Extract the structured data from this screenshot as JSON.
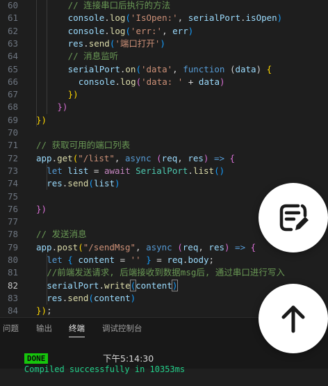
{
  "editor": {
    "lines": [
      {
        "n": "60",
        "tokens": [
          {
            "t": "// 连接串口后执行的方法",
            "c": "t-cmt"
          }
        ]
      },
      {
        "n": "61",
        "tokens": [
          {
            "t": "console",
            "c": "t-var"
          },
          {
            "t": ".",
            "c": "t-plain"
          },
          {
            "t": "log",
            "c": "t-fn"
          },
          {
            "t": "(",
            "c": "t-brk3"
          },
          {
            "t": "'IsOpen:'",
            "c": "t-str"
          },
          {
            "t": ", ",
            "c": "t-plain"
          },
          {
            "t": "serialPort",
            "c": "t-var"
          },
          {
            "t": ".",
            "c": "t-plain"
          },
          {
            "t": "isOpen",
            "c": "t-var"
          },
          {
            "t": ")",
            "c": "t-brk3"
          }
        ]
      },
      {
        "n": "62",
        "tokens": [
          {
            "t": "console",
            "c": "t-var"
          },
          {
            "t": ".",
            "c": "t-plain"
          },
          {
            "t": "log",
            "c": "t-fn"
          },
          {
            "t": "(",
            "c": "t-brk3"
          },
          {
            "t": "'err:'",
            "c": "t-str"
          },
          {
            "t": ", ",
            "c": "t-plain"
          },
          {
            "t": "err",
            "c": "t-var"
          },
          {
            "t": ")",
            "c": "t-brk3"
          }
        ]
      },
      {
        "n": "63",
        "tokens": [
          {
            "t": "res",
            "c": "t-var"
          },
          {
            "t": ".",
            "c": "t-plain"
          },
          {
            "t": "send",
            "c": "t-fn"
          },
          {
            "t": "(",
            "c": "t-brk3"
          },
          {
            "t": "'端口打开'",
            "c": "t-str"
          },
          {
            "t": ")",
            "c": "t-brk3"
          }
        ]
      },
      {
        "n": "64",
        "tokens": [
          {
            "t": "// 消息监听",
            "c": "t-cmt"
          }
        ]
      },
      {
        "n": "65",
        "tokens": [
          {
            "t": "serialPort",
            "c": "t-var"
          },
          {
            "t": ".",
            "c": "t-plain"
          },
          {
            "t": "on",
            "c": "t-fn"
          },
          {
            "t": "(",
            "c": "t-brk3"
          },
          {
            "t": "'data'",
            "c": "t-str"
          },
          {
            "t": ", ",
            "c": "t-plain"
          },
          {
            "t": "function",
            "c": "t-kw"
          },
          {
            "t": " (",
            "c": "t-plain"
          },
          {
            "t": "data",
            "c": "t-var"
          },
          {
            "t": ") ",
            "c": "t-plain"
          },
          {
            "t": "{",
            "c": "t-brk1"
          }
        ]
      },
      {
        "n": "66",
        "tokens": [
          {
            "t": "console",
            "c": "t-var"
          },
          {
            "t": ".",
            "c": "t-plain"
          },
          {
            "t": "log",
            "c": "t-fn"
          },
          {
            "t": "(",
            "c": "t-brk2"
          },
          {
            "t": "'data: '",
            "c": "t-str"
          },
          {
            "t": " + ",
            "c": "t-plain"
          },
          {
            "t": "data",
            "c": "t-var"
          },
          {
            "t": ")",
            "c": "t-brk2"
          }
        ]
      },
      {
        "n": "67",
        "tokens": [
          {
            "t": "})",
            "c": "t-brk1"
          }
        ]
      },
      {
        "n": "68",
        "tokens": [
          {
            "t": "})",
            "c": "t-brk2"
          }
        ]
      },
      {
        "n": "69",
        "tokens": [
          {
            "t": "})",
            "c": "t-brk1"
          }
        ]
      },
      {
        "n": "70",
        "tokens": []
      },
      {
        "n": "71",
        "tokens": [
          {
            "t": "// 获取可用的端口列表",
            "c": "t-cmt"
          }
        ]
      },
      {
        "n": "72",
        "tokens": [
          {
            "t": "app",
            "c": "t-var"
          },
          {
            "t": ".",
            "c": "t-plain"
          },
          {
            "t": "get",
            "c": "t-fn"
          },
          {
            "t": "(",
            "c": "t-brk1"
          },
          {
            "t": "\"/list\"",
            "c": "t-str"
          },
          {
            "t": ", ",
            "c": "t-plain"
          },
          {
            "t": "async",
            "c": "t-kw"
          },
          {
            "t": " (",
            "c": "t-brk2"
          },
          {
            "t": "req",
            "c": "t-var"
          },
          {
            "t": ", ",
            "c": "t-plain"
          },
          {
            "t": "res",
            "c": "t-var"
          },
          {
            "t": ")",
            "c": "t-brk2"
          },
          {
            "t": " => ",
            "c": "t-kw"
          },
          {
            "t": "{",
            "c": "t-brk2"
          }
        ]
      },
      {
        "n": "73",
        "tokens": [
          {
            "t": "let",
            "c": "t-kw"
          },
          {
            "t": " ",
            "c": "t-plain"
          },
          {
            "t": "list",
            "c": "t-var"
          },
          {
            "t": " = ",
            "c": "t-plain"
          },
          {
            "t": "await",
            "c": "t-ctl"
          },
          {
            "t": " ",
            "c": "t-plain"
          },
          {
            "t": "SerialPort",
            "c": "t-cls"
          },
          {
            "t": ".",
            "c": "t-plain"
          },
          {
            "t": "list",
            "c": "t-fn"
          },
          {
            "t": "()",
            "c": "t-brk3"
          }
        ]
      },
      {
        "n": "74",
        "tokens": [
          {
            "t": "res",
            "c": "t-var"
          },
          {
            "t": ".",
            "c": "t-plain"
          },
          {
            "t": "send",
            "c": "t-fn"
          },
          {
            "t": "(",
            "c": "t-brk3"
          },
          {
            "t": "list",
            "c": "t-var"
          },
          {
            "t": ")",
            "c": "t-brk3"
          }
        ]
      },
      {
        "n": "75",
        "tokens": []
      },
      {
        "n": "76",
        "tokens": [
          {
            "t": "})",
            "c": "t-brk2"
          }
        ]
      },
      {
        "n": "77",
        "tokens": []
      },
      {
        "n": "78",
        "tokens": [
          {
            "t": "// 发送消息",
            "c": "t-cmt"
          }
        ]
      },
      {
        "n": "79",
        "tokens": [
          {
            "t": "app",
            "c": "t-var"
          },
          {
            "t": ".",
            "c": "t-plain"
          },
          {
            "t": "post",
            "c": "t-fn"
          },
          {
            "t": "(",
            "c": "t-brk1"
          },
          {
            "t": "\"/sendMsg\"",
            "c": "t-str"
          },
          {
            "t": ", ",
            "c": "t-plain"
          },
          {
            "t": "async",
            "c": "t-kw"
          },
          {
            "t": " (",
            "c": "t-brk2"
          },
          {
            "t": "req",
            "c": "t-var"
          },
          {
            "t": ", ",
            "c": "t-plain"
          },
          {
            "t": "res",
            "c": "t-var"
          },
          {
            "t": ")",
            "c": "t-brk2"
          },
          {
            "t": " => ",
            "c": "t-kw"
          },
          {
            "t": "{",
            "c": "t-brk2"
          }
        ]
      },
      {
        "n": "80",
        "tokens": [
          {
            "t": "let",
            "c": "t-kw"
          },
          {
            "t": " ",
            "c": "t-plain"
          },
          {
            "t": "{",
            "c": "t-brk3"
          },
          {
            "t": " ",
            "c": "t-plain"
          },
          {
            "t": "content",
            "c": "t-var"
          },
          {
            "t": " = ",
            "c": "t-plain"
          },
          {
            "t": "''",
            "c": "t-str"
          },
          {
            "t": " ",
            "c": "t-plain"
          },
          {
            "t": "}",
            "c": "t-brk3"
          },
          {
            "t": " = ",
            "c": "t-plain"
          },
          {
            "t": "req",
            "c": "t-var"
          },
          {
            "t": ".",
            "c": "t-plain"
          },
          {
            "t": "body",
            "c": "t-var"
          },
          {
            "t": ";",
            "c": "t-plain"
          }
        ]
      },
      {
        "n": "81",
        "tokens": [
          {
            "t": "//前端发送请求, 后端接收到数据msg后, 通过串口进行写入",
            "c": "t-cmt"
          }
        ]
      },
      {
        "n": "82",
        "tokens": [
          {
            "t": "serialPort",
            "c": "t-var"
          },
          {
            "t": ".",
            "c": "t-plain"
          },
          {
            "t": "write",
            "c": "t-fn"
          },
          {
            "t": "(",
            "c": "t-brk3 cursor-box"
          },
          {
            "t": "content",
            "c": "t-var"
          },
          {
            "t": ")",
            "c": "t-brk3 cursor-box"
          }
        ]
      },
      {
        "n": "83",
        "tokens": [
          {
            "t": "res",
            "c": "t-var"
          },
          {
            "t": ".",
            "c": "t-plain"
          },
          {
            "t": "send",
            "c": "t-fn"
          },
          {
            "t": "(",
            "c": "t-brk3"
          },
          {
            "t": "content",
            "c": "t-var"
          },
          {
            "t": ")",
            "c": "t-brk3"
          }
        ]
      },
      {
        "n": "84",
        "tokens": [
          {
            "t": "})",
            "c": "t-brk1"
          },
          {
            "t": ";",
            "c": "t-plain"
          }
        ]
      }
    ],
    "active_line": "82"
  },
  "panel": {
    "tabs": [
      "问题",
      "输出",
      "终端",
      "调试控制台"
    ],
    "active_tab": "终端"
  },
  "terminal": {
    "badge": "DONE",
    "message": "Compiled successfully in 10353ms",
    "timestamp": "下午5:14:30"
  },
  "fabs": {
    "edit_icon": "edit-note-icon",
    "up_icon": "arrow-up-icon"
  },
  "colors": {
    "editor_bg": "#1e1e1e",
    "done_green": "#16c60c",
    "success_text": "#23d18b"
  }
}
